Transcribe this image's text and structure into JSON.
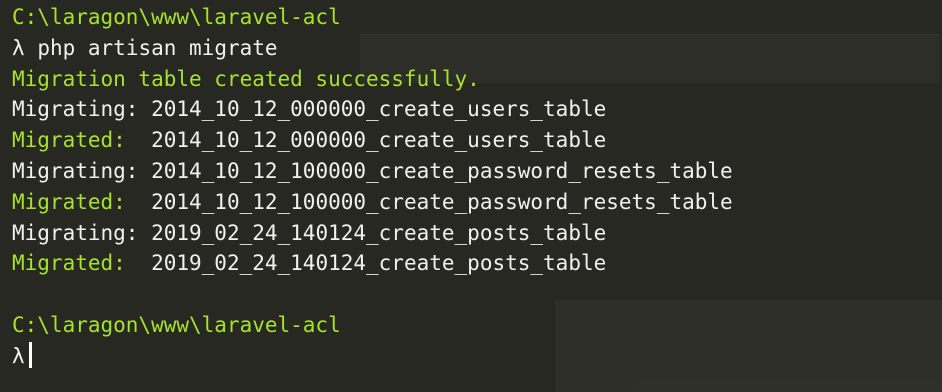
{
  "terminal": {
    "first_prompt_path": "C:\\laragon\\www\\laravel-acl",
    "prompt_symbol": "λ",
    "command": "php artisan migrate",
    "output": [
      {
        "label": "Migration table created successfully.",
        "name": "",
        "type": "success"
      },
      {
        "label": "Migrating:",
        "name": "2014_10_12_000000_create_users_table",
        "type": "migrating"
      },
      {
        "label": "Migrated: ",
        "name": "2014_10_12_000000_create_users_table",
        "type": "migrated"
      },
      {
        "label": "Migrating:",
        "name": "2014_10_12_100000_create_password_resets_table",
        "type": "migrating"
      },
      {
        "label": "Migrated: ",
        "name": "2014_10_12_100000_create_password_resets_table",
        "type": "migrated"
      },
      {
        "label": "Migrating:",
        "name": "2019_02_24_140124_create_posts_table",
        "type": "migrating"
      },
      {
        "label": "Migrated: ",
        "name": "2019_02_24_140124_create_posts_table",
        "type": "migrated"
      }
    ],
    "second_prompt_path": "C:\\laragon\\www\\laravel-acl"
  },
  "colors": {
    "background": "#272822",
    "path_green": "#a6e22e",
    "text": "#f0f0f0"
  }
}
